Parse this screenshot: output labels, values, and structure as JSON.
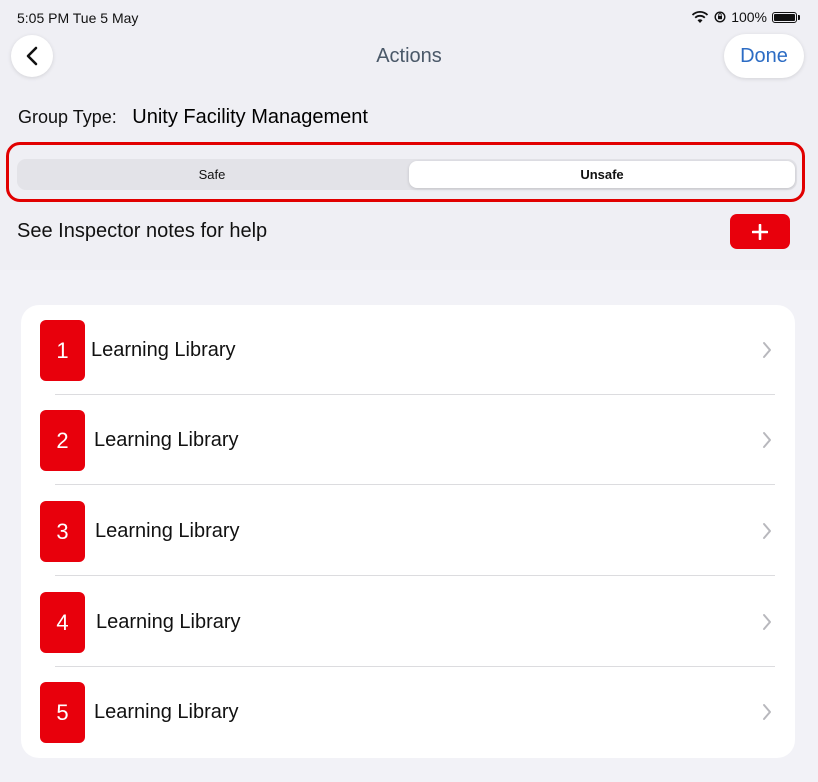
{
  "status_bar": {
    "time": "5:05 PM  Tue 5 May",
    "battery": "100%",
    "icons": [
      "wifi-icon",
      "orientation-lock-icon",
      "battery-icon"
    ]
  },
  "nav": {
    "back_icon": "chevron-left-icon",
    "title": "Actions",
    "done_label": "Done"
  },
  "group": {
    "label": "Group Type:",
    "value": "Unity Facility Management"
  },
  "segmented": {
    "options": [
      "Safe",
      "Unsafe"
    ],
    "selected": "Unsafe"
  },
  "help": {
    "text": "See Inspector notes for help",
    "add_icon": "plus-icon"
  },
  "items": [
    {
      "number": "1",
      "label": "Learning Library"
    },
    {
      "number": "2",
      "label": "Learning Library"
    },
    {
      "number": "3",
      "label": "Learning Library"
    },
    {
      "number": "4",
      "label": "Learning Library"
    },
    {
      "number": "5",
      "label": "Learning Library"
    }
  ],
  "colors": {
    "accent_red": "#e8000c",
    "highlight_red": "#e10000",
    "link_blue": "#2c6cc4",
    "background": "#efeff4"
  }
}
